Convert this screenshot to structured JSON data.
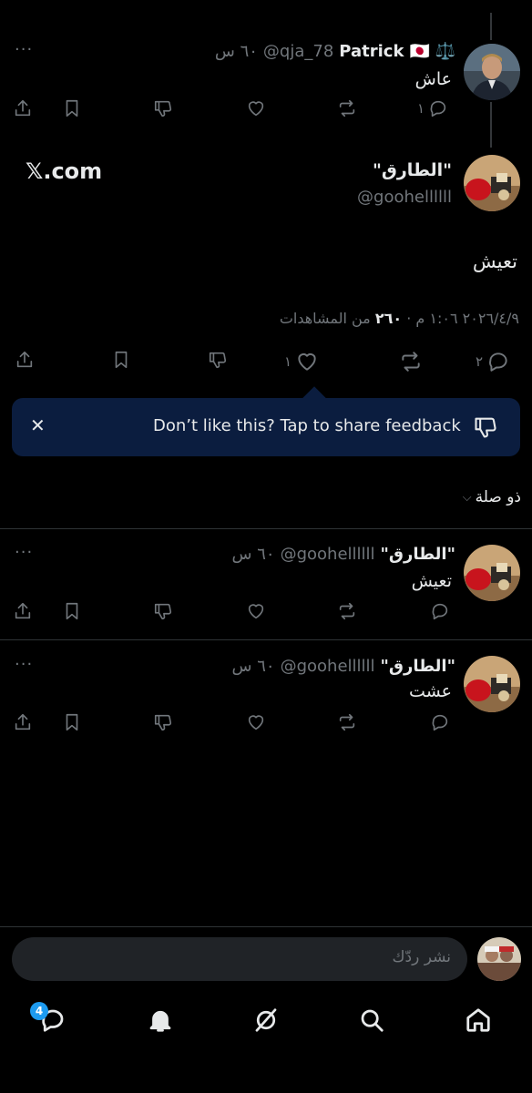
{
  "colors": {
    "background": "#000000",
    "text": "#e7e9ea",
    "muted": "#71767b",
    "accent": "#1d9bf0",
    "feedback_bg": "#0b1d3f"
  },
  "parent_tweet": {
    "name": "Patrick",
    "badges": "🇯🇵 ⚖️",
    "handle": "@qja_78",
    "time": "٦٠ س",
    "text": "عاش",
    "more": "···",
    "reply_count": "١",
    "icons": [
      "share-icon",
      "bookmark-icon",
      "dislike-icon",
      "like-icon",
      "retweet-icon",
      "reply-icon"
    ]
  },
  "main_tweet": {
    "name": "\"الطارق\"",
    "handle": "@goohellllll",
    "watermark": "𝕏.com",
    "text": "تعيش",
    "date_line": "٤/٩/‏٢٠٢٦‏ ١:٠٦ م",
    "views_count": "٢٦٠",
    "views_label": "من المشاهدات",
    "reply_count": "٢",
    "like_count": "١"
  },
  "feedback": {
    "text": "Don’t like this? Tap to share feedback",
    "close": "✕"
  },
  "sort": {
    "label": "ذو صلة"
  },
  "replies": [
    {
      "name": "\"الطارق\"",
      "handle": "@goohellllll",
      "time": "٦٠ س",
      "text": "تعيش",
      "more": "···"
    },
    {
      "name": "\"الطارق\"",
      "handle": "@goohellllll",
      "time": "٦٠ س",
      "text": "عشت",
      "more": "···"
    }
  ],
  "composer": {
    "placeholder": "نشر ردّك"
  },
  "bottom_nav": {
    "badge_count": "4",
    "items": [
      "messages-icon",
      "notifications-icon",
      "grok-icon",
      "search-icon",
      "home-icon"
    ]
  }
}
